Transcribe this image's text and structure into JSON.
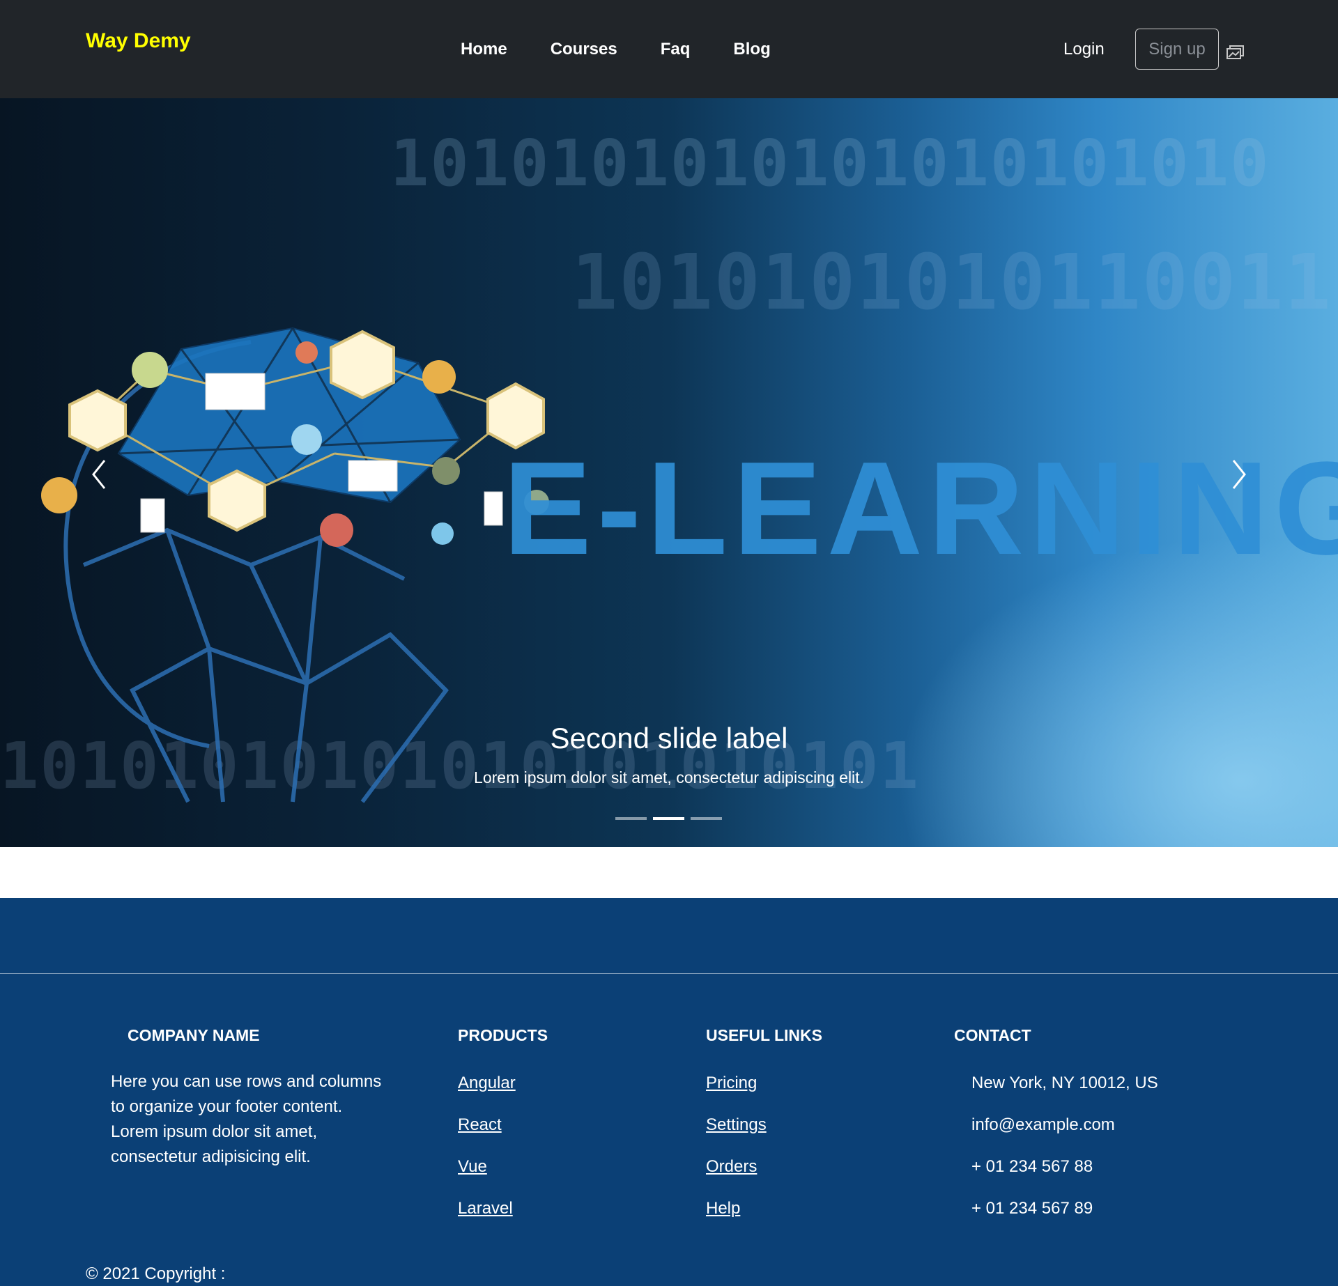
{
  "navbar": {
    "brand": "Way Demy",
    "links": [
      "Home",
      "Courses",
      "Faq",
      "Blog"
    ],
    "login_label": "Login",
    "signup_label": "Sign up",
    "brand_color": "#ffff00",
    "background": "#212529"
  },
  "carousel": {
    "image_text": "E-LEARNING",
    "caption_title": "Second slide label",
    "caption_text": "Lorem ipsum dolor sit amet, consectetur adipiscing elit.",
    "slide_count": 3,
    "active_index": 1,
    "prev_icon": "chevron-left-icon",
    "next_icon": "chevron-right-icon"
  },
  "footer": {
    "background": "#0b4076",
    "company": {
      "title": "COMPANY NAME",
      "text": "Here you can use rows and columns to organize your footer content. Lorem ipsum dolor sit amet, consectetur adipisicing elit."
    },
    "products": {
      "title": "PRODUCTS",
      "items": [
        "Angular",
        "React",
        "Vue",
        "Laravel"
      ]
    },
    "useful_links": {
      "title": "USEFUL LINKS",
      "items": [
        "Pricing",
        "Settings",
        "Orders",
        "Help"
      ]
    },
    "contact": {
      "title": "CONTACT",
      "address": "New York, NY 10012, US",
      "email": "info@example.com",
      "phone1": "+ 01 234 567 88",
      "phone2": "+ 01 234 567 89"
    },
    "copyright": "© 2021 Copyright :"
  }
}
